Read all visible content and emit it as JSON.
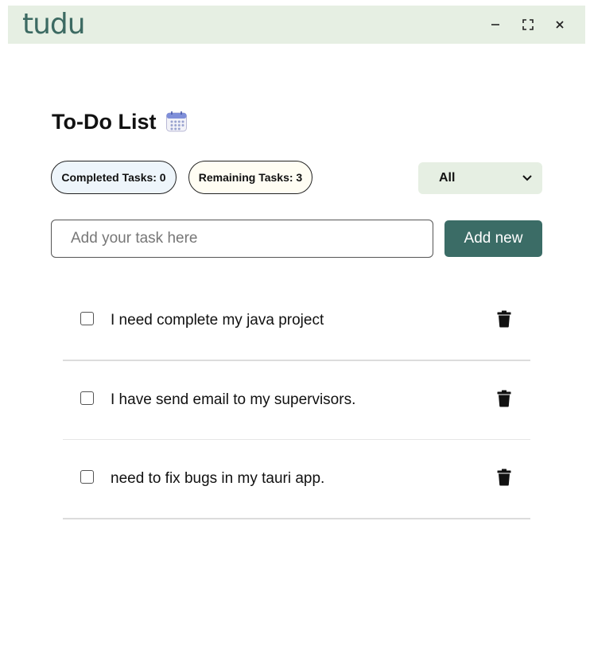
{
  "app": {
    "brand": "tudu"
  },
  "window_controls": {
    "minimize": "–",
    "maximize": "⛶",
    "close": "✕"
  },
  "header": {
    "title": "To-Do List",
    "title_icon": "calendar-icon"
  },
  "stats": {
    "completed": "Completed Tasks: 0",
    "remaining": "Remaining Tasks: 3"
  },
  "filter": {
    "selected": "All"
  },
  "new_task": {
    "placeholder": "Add your task here",
    "value": "",
    "button_label": "Add new"
  },
  "tasks": [
    {
      "text": "I need complete my java project",
      "done": false
    },
    {
      "text": "I have send email to my supervisors.",
      "done": false
    },
    {
      "text": "need to fix bugs in my tauri app.",
      "done": false
    }
  ],
  "colors": {
    "titlebar": "#e6efe3",
    "brand": "#3c6a62",
    "accent": "#3b6c66"
  }
}
